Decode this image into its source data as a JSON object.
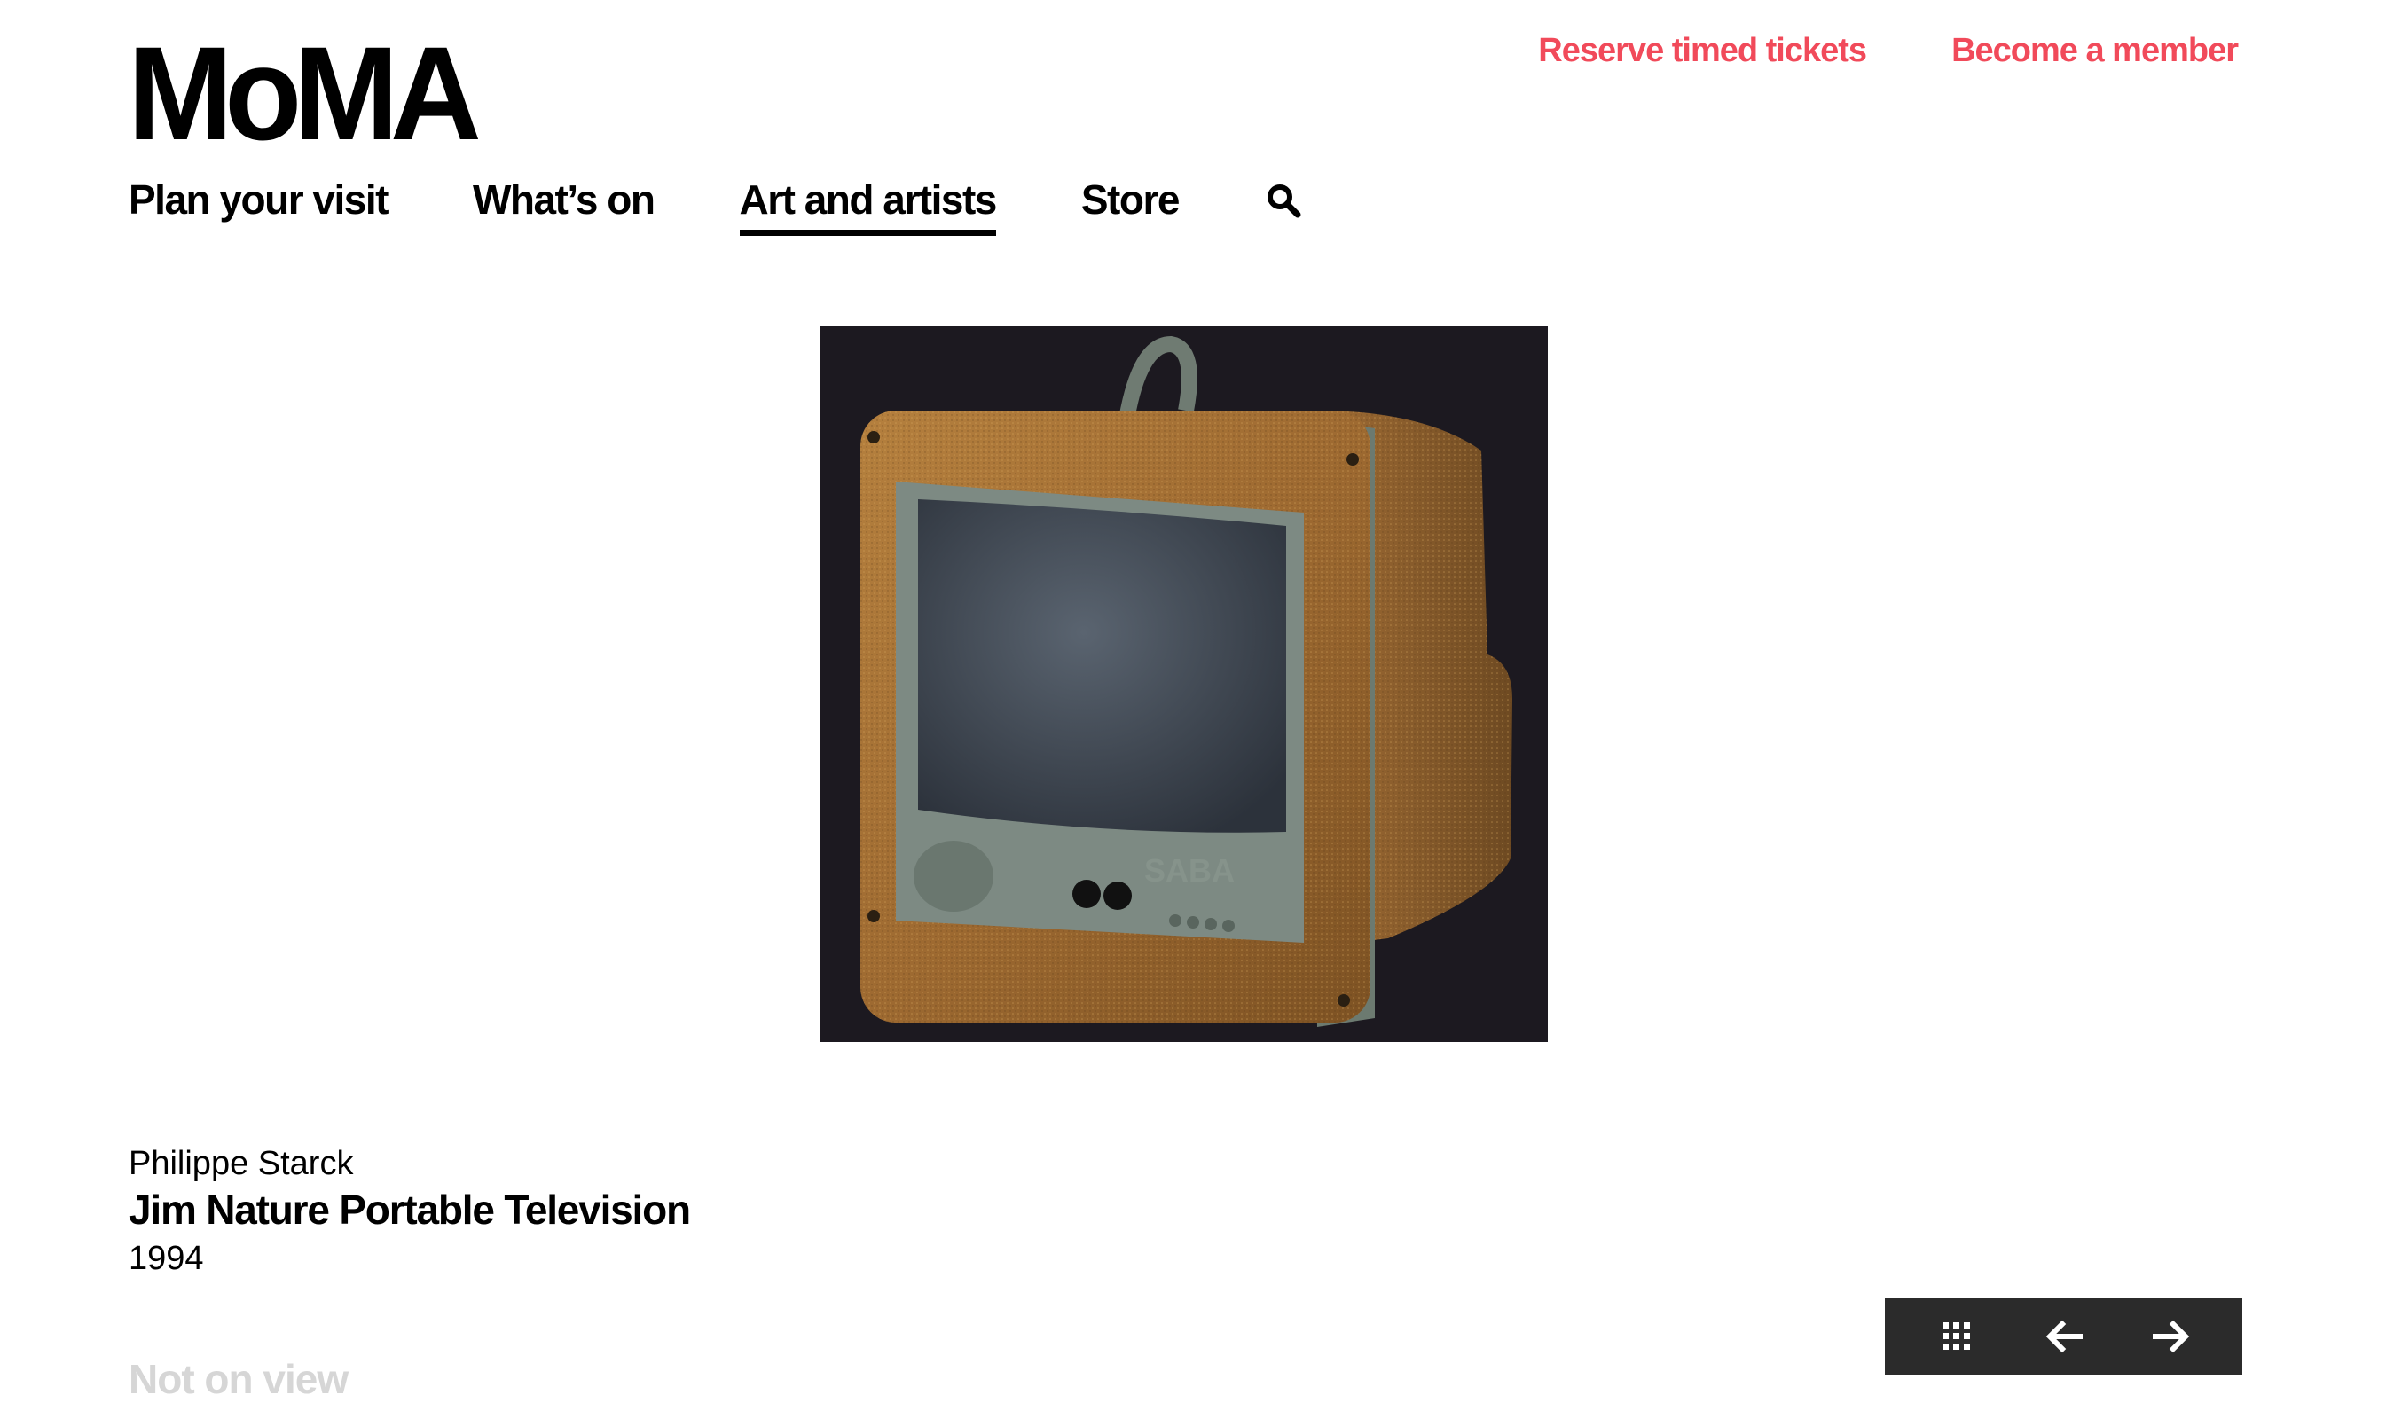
{
  "header": {
    "logo": "MoMA",
    "top_links": [
      "Reserve timed tickets",
      "Become a member"
    ],
    "accent_color": "#f14a5a"
  },
  "nav": {
    "items": [
      "Plan your visit",
      "What’s on",
      "Art and artists",
      "Store"
    ],
    "active": "Art and artists",
    "search_icon": "search-icon"
  },
  "artwork": {
    "artist": "Philippe Starck",
    "title": "Jim Nature Portable Television",
    "date": "1994",
    "image_label": "SABA"
  },
  "below_fold": {
    "partial_heading": "Not on view"
  },
  "controls": {
    "icons": [
      "grid-icon",
      "arrow-left-icon",
      "arrow-right-icon"
    ],
    "background": "#2b2b2b"
  }
}
